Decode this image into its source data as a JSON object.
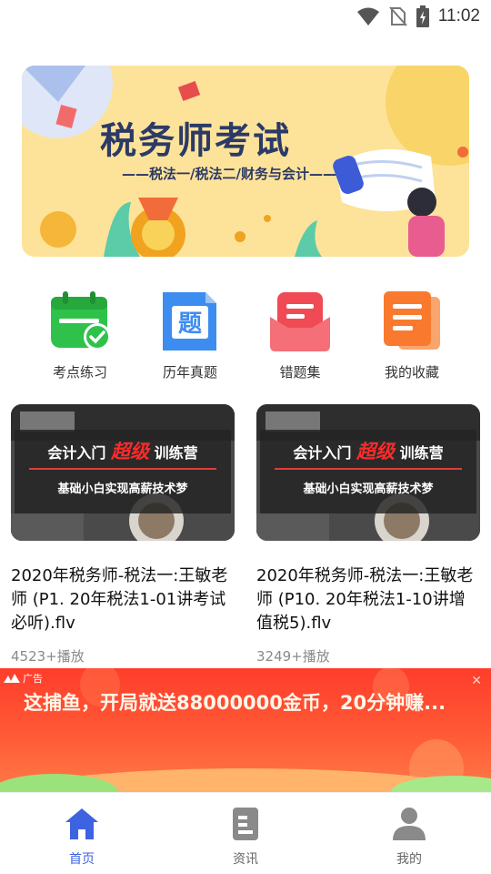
{
  "status_bar": {
    "time": "11:02"
  },
  "banner": {
    "title": "税务师考试",
    "subtitle": "——税法一/税法二/财务与会计——"
  },
  "quick_actions": [
    {
      "label": "考点练习",
      "icon": "calendar-check-icon",
      "color": "#2fc24a"
    },
    {
      "label": "历年真题",
      "icon": "question-doc-icon",
      "color": "#3d8cf0"
    },
    {
      "label": "错题集",
      "icon": "mail-tray-icon",
      "color": "#f04a55"
    },
    {
      "label": "我的收藏",
      "icon": "document-stack-icon",
      "color": "#f97a2e"
    }
  ],
  "videos": [
    {
      "thumb_line1_a": "会计入门",
      "thumb_line1_hl": "超级",
      "thumb_line1_b": "训练营",
      "thumb_line2": "基础小白实现高薪技术梦",
      "title": "2020年税务师-税法一:王敏老师 (P1. 20年税法1-01讲考试必听).flv",
      "plays": "4523+播放"
    },
    {
      "thumb_line1_a": "会计入门",
      "thumb_line1_hl": "超级",
      "thumb_line1_b": "训练营",
      "thumb_line2": "基础小白实现高薪技术梦",
      "title": "2020年税务师-税法一:王敏老师 (P10. 20年税法1-10讲增值税5).flv",
      "plays": "3249+播放"
    }
  ],
  "ad": {
    "tag": "广告",
    "text": "这捕鱼，开局就送88000000金币，20分钟赚..."
  },
  "tab_bar": {
    "active": 0,
    "items": [
      {
        "label": "首页",
        "icon": "home-icon"
      },
      {
        "label": "资讯",
        "icon": "news-icon"
      },
      {
        "label": "我的",
        "icon": "user-icon"
      }
    ]
  },
  "colors": {
    "accent": "#3d63e0",
    "ad_red": "#ff3d2b"
  }
}
